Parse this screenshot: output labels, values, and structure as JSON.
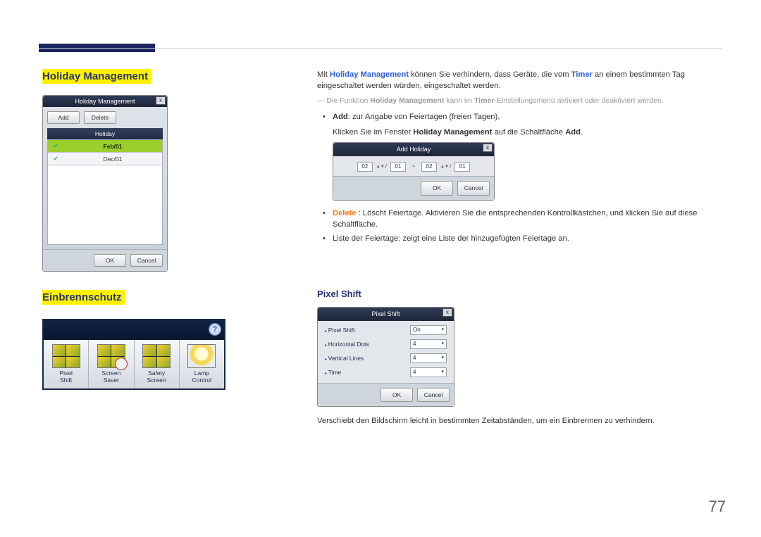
{
  "headings": {
    "holiday_management": "Holiday Management",
    "einbrennschutz": "Einbrennschutz",
    "pixel_shift": "Pixel Shift"
  },
  "body": {
    "intro_1a": "Mit ",
    "intro_1b": "Holiday Management",
    "intro_1c": " können Sie verhindern, dass Geräte, die vom ",
    "intro_1d": "Timer",
    "intro_1e": " an einem bestimmten Tag eingeschaltet werden würden, eingeschaltet werden.",
    "note_dash": "―",
    "note_1a": "Die Funktion ",
    "note_1b": "Holiday Management",
    "note_1c": " kann im ",
    "note_1d": "Timer",
    "note_1e": "-Einstellungsmenü aktiviert oder deaktiviert werden.",
    "bullet_add_a": "Add",
    "bullet_add_b": ": zur Angabe von Feiertagen (freien Tagen).",
    "bullet_add_sub_a": "Klicken Sie im Fenster ",
    "bullet_add_sub_b": "Holiday Management",
    "bullet_add_sub_c": " auf die Schaltfläche ",
    "bullet_add_sub_d": "Add",
    "bullet_add_sub_e": ".",
    "bullet_delete_a": "Delete",
    "bullet_delete_b": " : Löscht Feiertage. Aktivieren Sie die entsprechenden Kontrollkästchen, und klicken Sie auf diese Schaltfläche.",
    "bullet_list": "Liste der Feiertage: zeigt eine Liste der hinzugefügten Feiertage an.",
    "pixel_shift_desc": "Verschiebt den Bildschirm leicht in bestimmten Zeitabständen, um ein Einbrennen zu verhindern."
  },
  "hm_panel": {
    "title": "Holiday Management",
    "close": "x",
    "add": "Add",
    "delete": "Delete",
    "col_header": "Holiday",
    "rows": [
      {
        "checked": "✔",
        "date": "Feb/01"
      },
      {
        "checked": "✔",
        "date": "Dec/01"
      }
    ],
    "ok": "OK",
    "cancel": "Cancel"
  },
  "add_panel": {
    "title": "Add Holiday",
    "close": "x",
    "m1": "02",
    "d1": "01",
    "sep": "~",
    "m2": "02",
    "d2": "01",
    "slash": "/",
    "ok": "OK",
    "cancel": "Cancel"
  },
  "ps_panel": {
    "title": "Pixel Shift",
    "close": "x",
    "rows": {
      "pixel_shift": {
        "label": "Pixel Shift",
        "value": "On"
      },
      "horizontal_dots": {
        "label": "Horizontal Dots",
        "value": "4"
      },
      "vertical_lines": {
        "label": "Vertical Lines",
        "value": "4"
      },
      "time": {
        "label": "Time",
        "value": "4"
      }
    },
    "ok": "OK",
    "cancel": "Cancel"
  },
  "strip": {
    "help": "?",
    "items": [
      {
        "line1": "Pixel",
        "line2": "Shift"
      },
      {
        "line1": "Screen",
        "line2": "Saver"
      },
      {
        "line1": "Safety",
        "line2": "Screen"
      },
      {
        "line1": "Lamp",
        "line2": "Control"
      }
    ]
  },
  "page_number": "77"
}
